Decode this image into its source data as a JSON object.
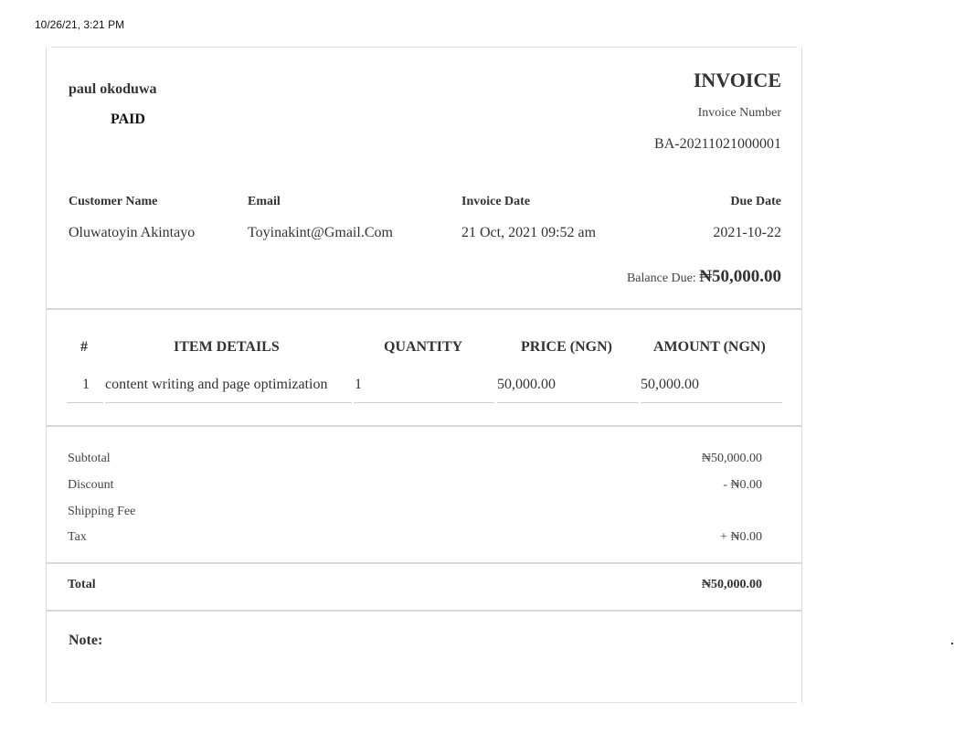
{
  "print_header": {
    "timestamp": "10/26/21, 3:21 PM"
  },
  "invoice": {
    "seller_name": "paul okoduwa",
    "status": "PAID",
    "title": "INVOICE",
    "number_label": "Invoice Number",
    "number": "BA-20211021000001",
    "customer_name_label": "Customer Name",
    "customer_name": "Oluwatoyin Akintayo",
    "email_label": "Email",
    "email": "Toyinakint@Gmail.Com",
    "invoice_date_label": "Invoice Date",
    "invoice_date": "21 Oct, 2021 09:52 am",
    "due_date_label": "Due Date",
    "due_date": "2021-10-22",
    "balance_due_label": "Balance Due:",
    "balance_due": "₦50,000.00"
  },
  "items_table": {
    "headers": [
      "#",
      "ITEM DETAILS",
      "QUANTITY",
      "PRICE (NGN)",
      "AMOUNT (NGN)"
    ],
    "rows": [
      {
        "index": "1",
        "details": "content writing and page optimization",
        "quantity": "1",
        "price": "50,000.00",
        "amount": "50,000.00"
      }
    ]
  },
  "summary": {
    "subtotal_label": "Subtotal",
    "subtotal": "₦50,000.00",
    "discount_label": "Discount",
    "discount": "- ₦0.00",
    "shipping_label": "Shipping Fee",
    "tax_label": "Tax",
    "tax": "+ ₦0.00",
    "total_label": "Total",
    "total": "₦50,000.00"
  },
  "note": {
    "label": "Note:"
  }
}
